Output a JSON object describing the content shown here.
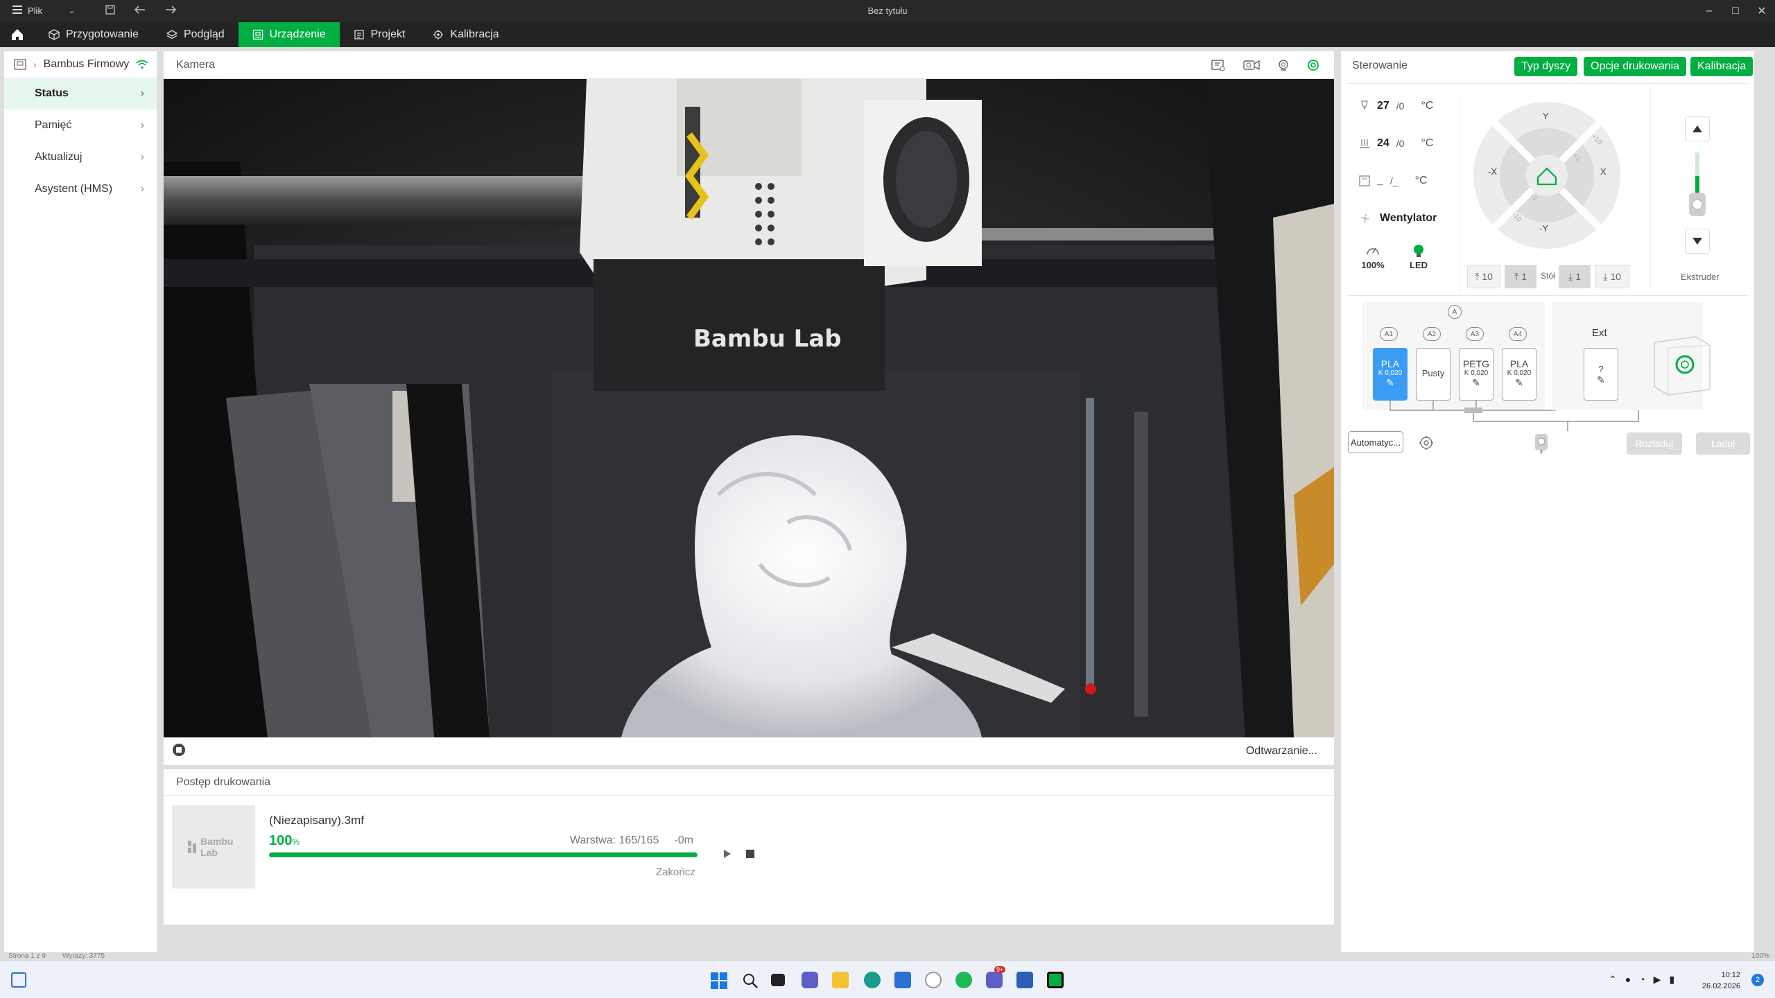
{
  "titlebar": {
    "file_menu": "Plik",
    "title": "Bez tytułu"
  },
  "tabs": [
    {
      "label": "Przygotowanie",
      "icon": "cube-icon"
    },
    {
      "label": "Podgląd",
      "icon": "layers-icon"
    },
    {
      "label": "Urządzenie",
      "icon": "device-icon",
      "active": true
    },
    {
      "label": "Projekt",
      "icon": "project-icon"
    },
    {
      "label": "Kalibracja",
      "icon": "calibration-icon"
    }
  ],
  "sidebar": {
    "device_name": "Bambus Firmowy",
    "items": [
      {
        "label": "Status",
        "active": true
      },
      {
        "label": "Pamięć"
      },
      {
        "label": "Aktualizuj"
      },
      {
        "label": "Asystent (HMS)"
      }
    ]
  },
  "camera": {
    "header": "Kamera",
    "playback_text": "Odtwarzanie...",
    "head_brand": "Bambu Lab"
  },
  "progress": {
    "header": "Postęp drukowania",
    "thumb_logo": "Bambu Lab",
    "filename": "(Niezapisany).3mf",
    "percent": "100",
    "percent_unit": "%",
    "progress_fraction": 1.0,
    "layer_text": "Warstwa: 165/165",
    "time_remaining": "-0m",
    "finish_label": "Zakończ"
  },
  "control": {
    "header": "Sterowanie",
    "buttons": {
      "nozzle_type": "Typ dyszy",
      "print_options": "Opcje drukowania",
      "calibration": "Kalibracja"
    },
    "temps": [
      {
        "current": "27",
        "target": "/0",
        "unit": "°C",
        "icon": "nozzle-temp-icon"
      },
      {
        "current": "24",
        "target": "/0",
        "unit": "°C",
        "icon": "bed-temp-icon"
      },
      {
        "current": "_",
        "target": "/_",
        "unit": "°C",
        "icon": "chamber-temp-icon"
      }
    ],
    "fan_label": "Wentylator",
    "speed_value": "100%",
    "led_label": "LED",
    "jog": {
      "y_plus": "Y",
      "y_minus": "-Y",
      "x_plus": "X",
      "x_minus": "-X",
      "step_big": "+10",
      "step_small": "+1",
      "step_small_neg": "-1",
      "step_big_neg": "-10"
    },
    "bed_buttons": {
      "up10": "10",
      "up1": "1",
      "label": "Stół",
      "down1": "1",
      "down10": "10"
    },
    "extruder_label": "Ekstruder",
    "ams": {
      "top_label": "A",
      "slots": [
        {
          "id": "A1",
          "name": "PLA",
          "k": "K 0,020",
          "selected": true
        },
        {
          "id": "A2",
          "name": "Pusty",
          "k": "",
          "selected": false
        },
        {
          "id": "A3",
          "name": "PETG",
          "k": "K 0,020",
          "selected": false
        },
        {
          "id": "A4",
          "name": "PLA",
          "k": "K 0,020",
          "selected": false
        }
      ],
      "ext_label": "Ext",
      "ext_slot": "?",
      "auto_button": "Automatyc...",
      "unload_button": "Rozładuj",
      "load_button": "Ładuj"
    }
  },
  "statusbar": {
    "page": "Strona 1 z 9",
    "words": "Wyrazy: 3775",
    "zoom": "100%"
  },
  "taskbar": {
    "time": "10:12",
    "date": "26.02.2026",
    "notif_count": "2",
    "teams_badge": "9+"
  }
}
